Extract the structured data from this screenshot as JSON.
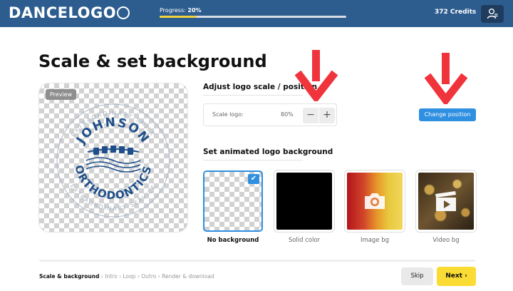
{
  "header": {
    "logo_text": "DANCELOGO",
    "progress_label": "Progress:",
    "progress_value": "20%",
    "progress_fraction": 0.2,
    "credits": "372 Credits"
  },
  "page": {
    "title": "Scale & set background"
  },
  "preview": {
    "tag": "Preview",
    "emblem_top": "JOHNSON",
    "emblem_bottom": "ORTHODONTICS",
    "emblem_ring_top": "EXTRAORDINARY SMILE",
    "emblem_ring_bottom": "EXTRAORDINARY SERVICE"
  },
  "scale": {
    "heading": "Adjust logo scale / position",
    "label": "Scale logo:",
    "value": "80%",
    "minus": "−",
    "plus": "+",
    "change_position": "Change position"
  },
  "background": {
    "heading": "Set animated logo background",
    "options": [
      {
        "label": "No background",
        "selected": true
      },
      {
        "label": "Solid color",
        "selected": false
      },
      {
        "label": "Image bg",
        "selected": false
      },
      {
        "label": "Video bg",
        "selected": false
      }
    ]
  },
  "footer": {
    "steps": [
      "Scale & background",
      "Intro",
      "Loop",
      "Outro",
      "Render & download"
    ],
    "separator": "›",
    "skip": "Skip",
    "next": "Next ›"
  },
  "colors": {
    "header_bg": "#2d5d8f",
    "accent_blue": "#2f8fe0",
    "next_yellow": "#fbdc34",
    "arrow_red": "#f0343c",
    "emblem_blue": "#1f4f8a"
  },
  "icons": {
    "user": "user-icon",
    "check": "check-icon",
    "camera": "camera-icon",
    "video": "video-clapper-icon"
  }
}
